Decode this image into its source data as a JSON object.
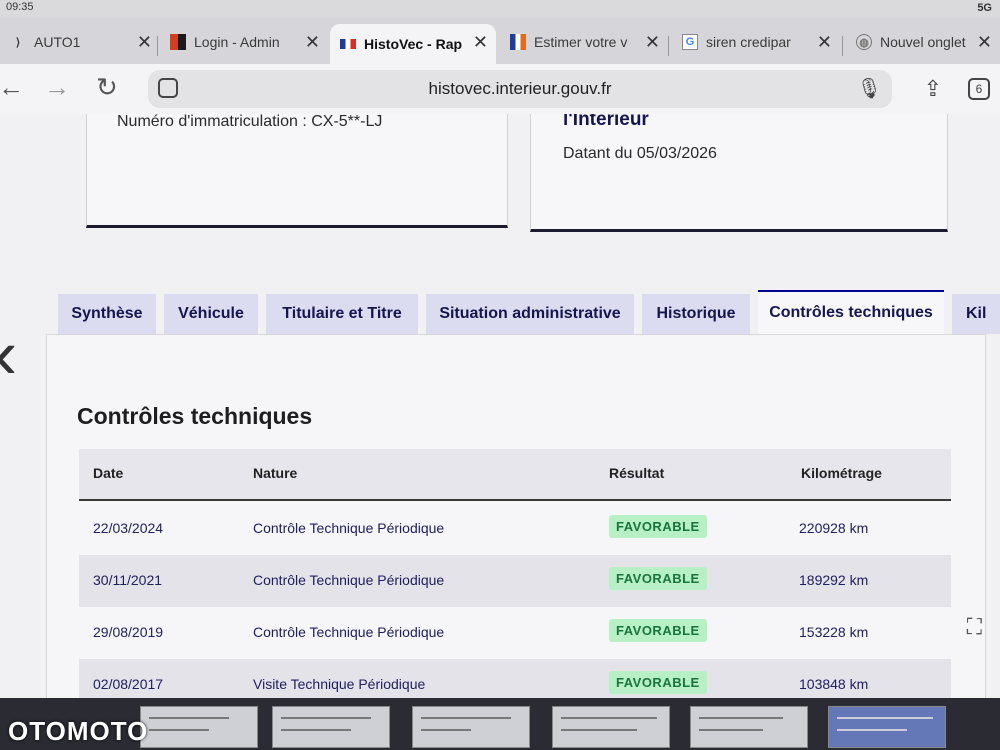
{
  "status": {
    "time": "09:35",
    "signal": "5G"
  },
  "browser_tabs": [
    {
      "title": "AUTO1",
      "icon": "auto1-icon"
    },
    {
      "title": "Login - Admin",
      "icon": "admin-icon"
    },
    {
      "title": "HistoVec - Rap",
      "icon": "france-flag-icon"
    },
    {
      "title": "Estimer votre v",
      "icon": "france-flag-icon"
    },
    {
      "title": "siren credipar",
      "icon": "google-icon"
    },
    {
      "title": "Nouvel onglet",
      "icon": "globe-icon"
    }
  ],
  "toolbar": {
    "url": "histovec.interieur.gouv.fr",
    "tab_count": "6"
  },
  "card_left": {
    "text": "Numéro d'immatriculation : CX-5**-LJ"
  },
  "card_right": {
    "heading": "l'Intérieur",
    "text": "Datant du 05/03/2026"
  },
  "page_tabs": [
    "Synthèse",
    "Véhicule",
    "Titulaire et Titre",
    "Situation administrative",
    "Historique",
    "Contrôles techniques",
    "Kil"
  ],
  "section_title": "Contrôles techniques",
  "table": {
    "headers": [
      "Date",
      "Nature",
      "Résultat",
      "Kilométrage"
    ],
    "rows": [
      {
        "date": "22/03/2024",
        "nature": "Contrôle Technique Périodique",
        "result": "FAVORABLE",
        "km": "220928 km"
      },
      {
        "date": "30/11/2021",
        "nature": "Contrôle Technique Périodique",
        "result": "FAVORABLE",
        "km": "189292 km"
      },
      {
        "date": "29/08/2019",
        "nature": "Contrôle Technique Périodique",
        "result": "FAVORABLE",
        "km": "153228 km"
      },
      {
        "date": "02/08/2017",
        "nature": "Visite Technique Périodique",
        "result": "FAVORABLE",
        "km": "103848 km"
      }
    ]
  },
  "watermark": "OTOMOTO",
  "colors": {
    "accent": "#000091",
    "badge_bg": "#b8f0c5",
    "badge_text": "#18753c"
  }
}
